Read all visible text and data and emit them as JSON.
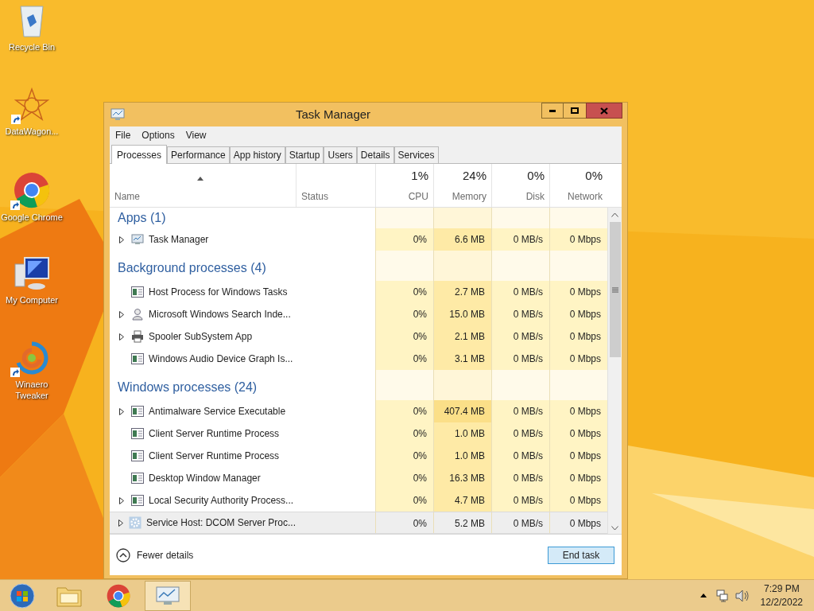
{
  "desktop_icons": [
    {
      "label": "Recycle Bin",
      "kind": "bin",
      "shortcut": false
    },
    {
      "label": "DataWagon...",
      "kind": "star",
      "shortcut": true
    },
    {
      "label": "Google Chrome",
      "kind": "chrome",
      "shortcut": true
    },
    {
      "label": "My Computer",
      "kind": "computer",
      "shortcut": false
    },
    {
      "label": "Winaero Tweaker",
      "kind": "swirl",
      "shortcut": true
    }
  ],
  "window": {
    "title": "Task Manager"
  },
  "menu": [
    "File",
    "Options",
    "View"
  ],
  "tabs": [
    {
      "label": "Processes",
      "selected": true
    },
    {
      "label": "Performance",
      "selected": false
    },
    {
      "label": "App history",
      "selected": false
    },
    {
      "label": "Startup",
      "selected": false
    },
    {
      "label": "Users",
      "selected": false
    },
    {
      "label": "Details",
      "selected": false
    },
    {
      "label": "Services",
      "selected": false
    }
  ],
  "columns": [
    {
      "label": "Name",
      "sorted": true
    },
    {
      "label": "Status",
      "sorted": false
    },
    {
      "label": "CPU",
      "total": "1%",
      "sorted": false
    },
    {
      "label": "Memory",
      "total": "24%",
      "sorted": false
    },
    {
      "label": "Disk",
      "total": "0%",
      "sorted": false
    },
    {
      "label": "Network",
      "total": "0%",
      "sorted": false
    }
  ],
  "groups": [
    {
      "title": "Apps (1)",
      "rows": [
        {
          "name": "Task Manager",
          "kind": "monitor",
          "expandable": true,
          "selected": false,
          "cpu": "0%",
          "memory": "6.6 MB",
          "memory_high": false,
          "disk": "0 MB/s",
          "network": "0 Mbps"
        }
      ]
    },
    {
      "title": "Background processes (4)",
      "rows": [
        {
          "name": "Host Process for Windows Tasks",
          "kind": "window",
          "expandable": false,
          "selected": false,
          "cpu": "0%",
          "memory": "2.7 MB",
          "memory_high": false,
          "disk": "0 MB/s",
          "network": "0 Mbps"
        },
        {
          "name": "Microsoft Windows Search Inde...",
          "kind": "user",
          "expandable": true,
          "selected": false,
          "cpu": "0%",
          "memory": "15.0 MB",
          "memory_high": false,
          "disk": "0 MB/s",
          "network": "0 Mbps"
        },
        {
          "name": "Spooler SubSystem App",
          "kind": "printer",
          "expandable": true,
          "selected": false,
          "cpu": "0%",
          "memory": "2.1 MB",
          "memory_high": false,
          "disk": "0 MB/s",
          "network": "0 Mbps"
        },
        {
          "name": "Windows Audio Device Graph Is...",
          "kind": "window",
          "expandable": false,
          "selected": false,
          "cpu": "0%",
          "memory": "3.1 MB",
          "memory_high": false,
          "disk": "0 MB/s",
          "network": "0 Mbps"
        }
      ]
    },
    {
      "title": "Windows processes (24)",
      "rows": [
        {
          "name": "Antimalware Service Executable",
          "kind": "window",
          "expandable": true,
          "selected": false,
          "cpu": "0%",
          "memory": "407.4 MB",
          "memory_high": true,
          "disk": "0 MB/s",
          "network": "0 Mbps"
        },
        {
          "name": "Client Server Runtime Process",
          "kind": "window",
          "expandable": false,
          "selected": false,
          "cpu": "0%",
          "memory": "1.0 MB",
          "memory_high": false,
          "disk": "0 MB/s",
          "network": "0 Mbps"
        },
        {
          "name": "Client Server Runtime Process",
          "kind": "window",
          "expandable": false,
          "selected": false,
          "cpu": "0%",
          "memory": "1.0 MB",
          "memory_high": false,
          "disk": "0 MB/s",
          "network": "0 Mbps"
        },
        {
          "name": "Desktop Window Manager",
          "kind": "window",
          "expandable": false,
          "selected": false,
          "cpu": "0%",
          "memory": "16.3 MB",
          "memory_high": false,
          "disk": "0 MB/s",
          "network": "0 Mbps"
        },
        {
          "name": "Local Security Authority Process...",
          "kind": "window",
          "expandable": true,
          "selected": false,
          "cpu": "0%",
          "memory": "4.7 MB",
          "memory_high": false,
          "disk": "0 MB/s",
          "network": "0 Mbps"
        },
        {
          "name": "Service Host: DCOM Server Proc...",
          "kind": "gear",
          "expandable": true,
          "selected": true,
          "cpu": "0%",
          "memory": "5.2 MB",
          "memory_high": false,
          "disk": "0 MB/s",
          "network": "0 Mbps"
        }
      ]
    }
  ],
  "footer": {
    "details_link": "Fewer details",
    "end_task": "End task"
  },
  "taskbar": {
    "items": [
      {
        "kind": "folder",
        "selected": false
      },
      {
        "kind": "chrome",
        "selected": false
      },
      {
        "kind": "monitor",
        "selected": true
      }
    ],
    "time": "7:29 PM",
    "date": "12/2/2022"
  }
}
